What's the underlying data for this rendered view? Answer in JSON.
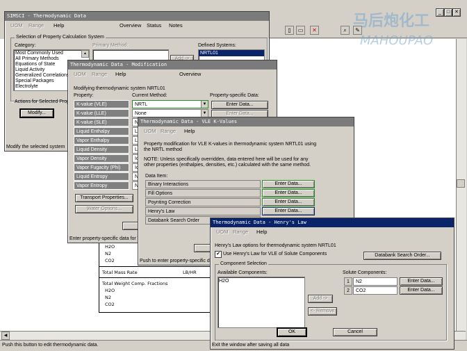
{
  "main": {
    "status": "Push this button to edit thermodynamic data.",
    "win_min": "_",
    "win_max": "□",
    "win_close": "✕"
  },
  "watermark": {
    "brand_cn": "马后炮化工",
    "brand_en": "MAHOUPAO"
  },
  "report": {
    "rows": [
      "H2O",
      "N2",
      "CO2"
    ],
    "total_mass": "Total Mass Rate",
    "unit": "LB/HR",
    "weight_frac": "Total Weight Comp. Fractions",
    "rows2": [
      "H2O",
      "N2",
      "CO2"
    ]
  },
  "w1": {
    "title": "SIMSCI - Thermodynamic Data",
    "menu": {
      "uom": "UOM",
      "range": "Range",
      "help": "Help",
      "overview": "Overview",
      "status": "Status",
      "notes": "Notes"
    },
    "group_label": "Selection of Property Calculation System",
    "category_label": "Category:",
    "primary_method_label": "Primary Method:",
    "defined_label": "Defined Systems:",
    "categories": [
      "Most Commonly Used",
      "All Primary Methods",
      "Equations of State",
      "Liquid Activity",
      "Generalized Correlations",
      "Special Packages",
      "Electrolyte"
    ],
    "defined": [
      "NRTL01"
    ],
    "add_button": "Add ->",
    "actions_label": "Actions for Selected Prop",
    "modify_button": "Modify...",
    "status": "Modify the selected system"
  },
  "w2": {
    "title": "Thermodynamic Data - Modification",
    "menu": {
      "uom": "UOM",
      "range": "Range",
      "help": "Help",
      "overview": "Overview"
    },
    "modifying": "Modifying thermodynamic system NRTL01",
    "col_property": "Property:",
    "col_method": "Current Method:",
    "col_data": "Property-specific Data:",
    "properties": [
      "K-value (VLE)",
      "K-value (LLE)",
      "K-value (SLE)",
      "Liquid Enthalpy",
      "Vapor Enthalpy",
      "Liquid Density",
      "Vapor Density",
      "Vapor Fugacity (Phi)",
      "Liquid Entropy",
      "Vapor Entropy"
    ],
    "methods": [
      "NRTL",
      "None",
      "N",
      "Li",
      "Li",
      "Li",
      "Ic",
      "Ic",
      "N",
      "N"
    ],
    "enter_data": "Enter Data...",
    "transport_button": "Transport Properties...",
    "water_button": "Water Options...",
    "status": "Enter property-specific data for V"
  },
  "w3": {
    "title": "Thermodynamic Data - VLE K-Values",
    "menu": {
      "uom": "UOM",
      "range": "Range",
      "help": "Help"
    },
    "desc1": "Property modification for VLE K-values in thermodynamic system NRTL01 using",
    "desc2": "the NRTL method",
    "note1": "NOTE: Unless specifically overridden, data entered here will be used for any",
    "note2": "other properties (enthalpies, densities, etc.) calculated with the same method.",
    "data_item": "Data Item:",
    "items": [
      "Binary Interactions",
      "Fill Options",
      "Poynting Correction",
      "Henry's Law",
      "Databank Search Order"
    ],
    "enter_data": "Enter Data...",
    "status": "Push to enter property-specific d"
  },
  "w4": {
    "title": "Thermodynamic Data - Henry's Law",
    "menu": {
      "uom": "UOM",
      "range": "Range",
      "help": "Help"
    },
    "desc": "Henry's Law options for thermodynamic system NRTL01",
    "checkbox": "Use Henry's Law for VLE of Solute Components",
    "databank_button": "Databank Search Order...",
    "component_selection": "Component Selection",
    "available_label": "Available Components:",
    "available": [
      "H2O"
    ],
    "solute_label": "Solute Components:",
    "solutes": [
      {
        "n": "1",
        "name": "N2"
      },
      {
        "n": "2",
        "name": "CO2"
      }
    ],
    "enter_data": "Enter Data...",
    "add_button": "Add ->",
    "remove_button": "<- Remove",
    "ok_button": "OK",
    "cancel_button": "Cancel",
    "status": "Exit the window after saving all data"
  }
}
